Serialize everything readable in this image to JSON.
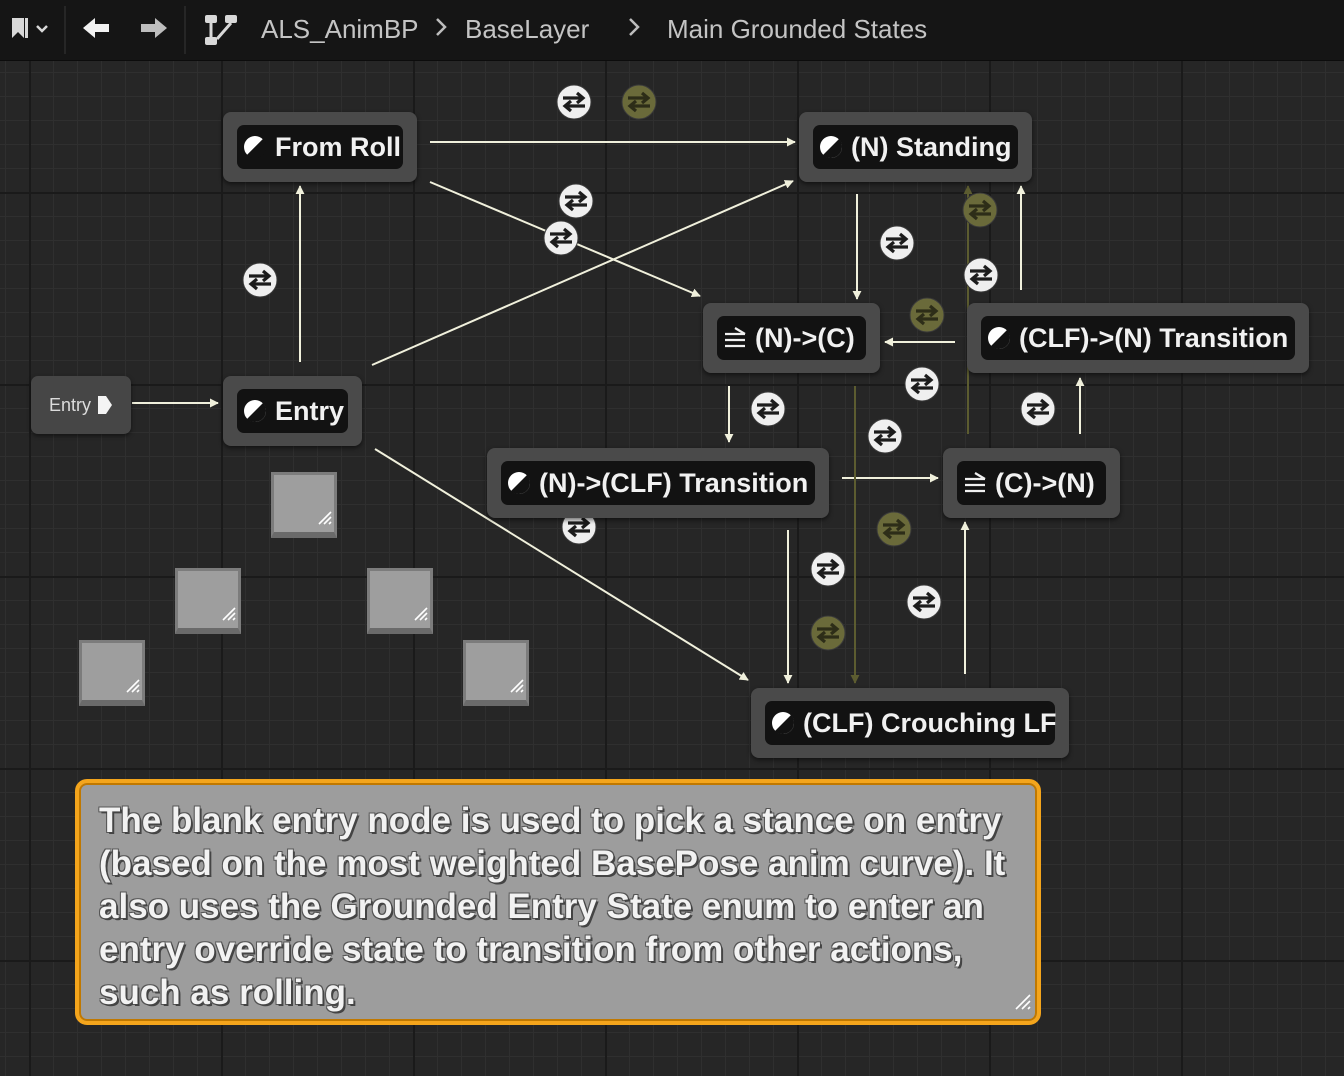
{
  "toolbar": {
    "breadcrumbs": [
      "ALS_AnimBP",
      "BaseLayer",
      "Main Grounded States"
    ]
  },
  "graph": {
    "entry_pin_label": "Entry",
    "states": {
      "from_roll": "From Roll",
      "n_standing": "(N) Standing",
      "entry": "Entry",
      "n_to_c": "(N)->(C)",
      "clf_to_n_transition": "(CLF)->(N) Transition",
      "n_to_clf_transition": "(N)->(CLF) Transition",
      "c_to_n": "(C)->(N)",
      "clf_crouching_lf": "(CLF) Crouching LF"
    }
  },
  "comment": {
    "text": "The blank entry node is used to pick a stance on entry (based on the most weighted BasePose anim curve). It also uses the Grounded Entry State enum to enter an entry override state to transition from other actions, such as rolling."
  },
  "colors": {
    "wire_active": "#f0f0dc",
    "wire_inactive": "#5c5c30",
    "transition_active": "#efefef",
    "transition_inactive": "#6a6a3a",
    "comment_border": "#f4a51c",
    "comment_fill": "#9d9d9d"
  },
  "icons": {
    "state": "half-moon-icon",
    "conduit_state": "blend-lines-icon",
    "transition": "bidirectional-arrows-icon"
  }
}
